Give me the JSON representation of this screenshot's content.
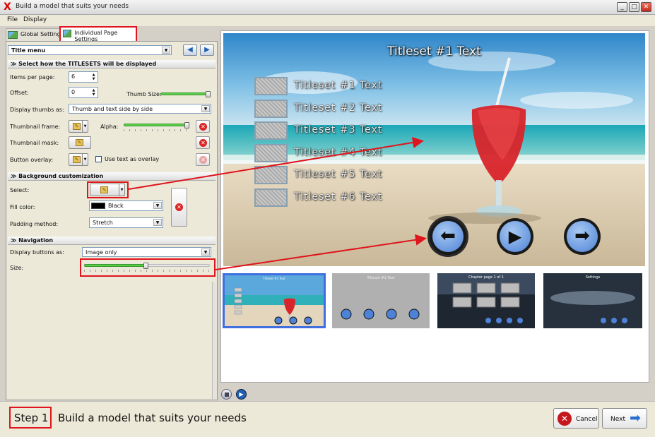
{
  "window": {
    "title": "Build a model that suits your needs",
    "logo": "X",
    "minimize": "_",
    "maximize": "□",
    "close": "✕"
  },
  "menu": [
    "File",
    "Display"
  ],
  "tabs": {
    "global": "Global Settings",
    "individual": "Individual Page Settings"
  },
  "page_select": {
    "value": "Title menu"
  },
  "titlesets_section": {
    "header": "Select how the TITLESETS will be displayed",
    "items_per_page_label": "Items per page:",
    "items_per_page": "6",
    "offset_label": "Offset:",
    "offset": "0",
    "thumb_size_label": "Thumb Size:",
    "thumb_size_level": 1.0,
    "display_thumbs_label": "Display thumbs as:",
    "display_thumbs_value": "Thumb and text side by side",
    "thumb_frame_label": "Thumbnail frame:",
    "alpha_label": "Alpha:",
    "alpha_level": 1.0,
    "thumb_mask_label": "Thumbnail mask:",
    "button_overlay_label": "Button overlay:",
    "use_text_overlay": "Use text as overlay"
  },
  "background_section": {
    "header": "Background customization",
    "select_label": "Select:",
    "fill_color_label": "Fill color:",
    "fill_color_value": "Black",
    "fill_color_hex": "#000000",
    "padding_label": "Padding method:",
    "padding_value": "Stretch"
  },
  "navigation_section": {
    "header": "Navigation",
    "display_buttons_label": "Display buttons as:",
    "display_buttons_value": "Image only",
    "size_label": "Size:",
    "size_level": 0.5
  },
  "preview": {
    "title": "Titleset #1 Text",
    "items": [
      "Titleset #1 Text",
      "Titleset #2 Text",
      "Titleset #3 Text",
      "Titleset #4 Text",
      "Titleset #5 Text",
      "Titleset #6 Text"
    ]
  },
  "thumbnails": [
    {
      "title": "Titleset #1 Text",
      "selected": true
    },
    {
      "title": "Titleset #1 Text",
      "selected": false
    },
    {
      "title": "Chapter page 1 of 1",
      "selected": false
    },
    {
      "title": "Settings",
      "selected": false
    }
  ],
  "footer": {
    "step": "Step 1",
    "description": "Build a model that suits your needs",
    "cancel": "Cancel",
    "next": "Next"
  },
  "colors": {
    "accent_red": "#e0141c",
    "slider_green": "#5ccd4a",
    "selection_blue": "#3f6fe0"
  }
}
